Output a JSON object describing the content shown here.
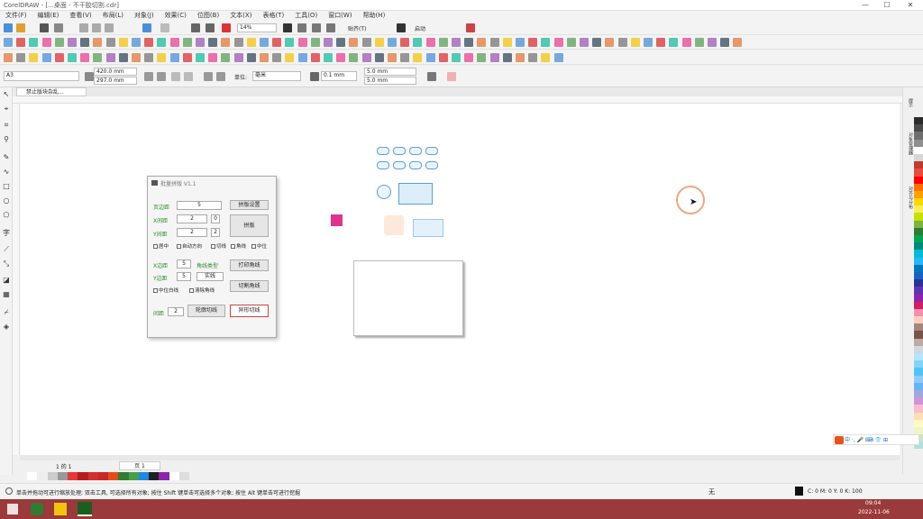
{
  "title_bar": {
    "text": "CorelDRAW - [...桌面 - 不干胶切割.cdr]",
    "minimize": "—",
    "maximize": "☐",
    "close": "✕"
  },
  "menu": [
    "文件(F)",
    "编辑(E)",
    "查看(V)",
    "布局(L)",
    "对象(J)",
    "效果(C)",
    "位图(B)",
    "文本(X)",
    "表格(T)",
    "工具(O)",
    "窗口(W)",
    "帮助(H)"
  ],
  "toolbar": {
    "zoom_value": "14%",
    "snap_label": "贴齐(T)",
    "launch_label": "启动"
  },
  "property_bar": {
    "page_preset": "A3",
    "width": "420.0 mm",
    "height": "297.0 mm",
    "units_label": "单位:",
    "units_value": "毫米",
    "nudge": "0.1 mm",
    "dup_x": "5.0 mm",
    "dup_y": "5.0 mm"
  },
  "doc_tab": "禁止版块杂乱...",
  "dialog": {
    "title": "批量拼版 V1.1",
    "page_margin_label": "页边距",
    "page_margin_value": "5",
    "x_spacing_label": "X间距",
    "x_spacing_value": "2",
    "y_spacing_label": "Y间距",
    "y_spacing_value": "2",
    "x_spin": "0",
    "y_spin": "2",
    "setup_button": "拼版设置",
    "impose_button": "拼版",
    "chk_center": "居中",
    "chk_auto": "自动方向",
    "chk_cut": "切线",
    "chk_corner": "角线",
    "chk_mid": "中位",
    "x_margin_label": "X边距",
    "x_margin_value": "5",
    "y_margin_label": "Y边距",
    "y_margin_value": "5",
    "line_type_label": "角线类型",
    "line_type_value": "实线",
    "print_mark_button": "打印角线",
    "cut_mark_button": "切割角线",
    "chk_mid_mark": "中位白线",
    "chk_clear": "清除角线",
    "spacing_label": "间距",
    "spacing_value": "2",
    "contour_button": "轮廓切线",
    "special_button": "异形切线"
  },
  "right_dock_tabs": [
    "提示",
    "对象管理器",
    "对齐与分布"
  ],
  "palette": [
    "#2b2b2b",
    "#4a4a4a",
    "#6e6e6e",
    "#8f8f8f",
    "#ffffff",
    "#d6d6d6",
    "#c0392b",
    "#e74c3c",
    "#ff0000",
    "#ff6f00",
    "#ffa000",
    "#ffd600",
    "#ffee58",
    "#c6e000",
    "#7cb342",
    "#2e7d32",
    "#00a651",
    "#00897b",
    "#00bcd4",
    "#29b6f6",
    "#0277bd",
    "#1565c0",
    "#283593",
    "#5e35b1",
    "#8e24aa",
    "#d81b60",
    "#f48fb1",
    "#ffccbc",
    "#a1887f",
    "#795548",
    "#bcaaa4",
    "#cfd8dc",
    "#b3e5fc",
    "#81d4fa",
    "#4fc3f7",
    "#90caf9",
    "#64b5f6",
    "#9fa8da",
    "#ce93d8",
    "#f8bbd0",
    "#ffe0b2",
    "#fff9c4",
    "#f0f4c3",
    "#c8e6c9",
    "#b2dfdb"
  ],
  "bottom_palette": [
    "#ffffff",
    "#ededed",
    "#cccccc",
    "#999999",
    "#e53935",
    "#b71c1c",
    "#d32f2f",
    "#c62828",
    "#e64a19",
    "#2e7d32",
    "#43a047",
    "#1e88e5",
    "#212121",
    "#8e24aa",
    "#ffffff",
    "#dddddd"
  ],
  "page_nav": {
    "counter": "1 的 1",
    "page_tab": "页 1"
  },
  "status": {
    "hint": "单击并拖动可进行缩放处理; 双击工具, 可选择所有对象; 按住 Shift 键单击可选择多个对象; 按住 Alt 键单击可进行挖掘",
    "fill_label": "无",
    "color_readout": "C: 0 M: 0 Y: 0 K: 100"
  },
  "ime_bar": "中 ·, 🎤 ⌨ 👕 ⊞",
  "taskbar": {
    "time": "09:04",
    "date": "2022-11-06"
  }
}
